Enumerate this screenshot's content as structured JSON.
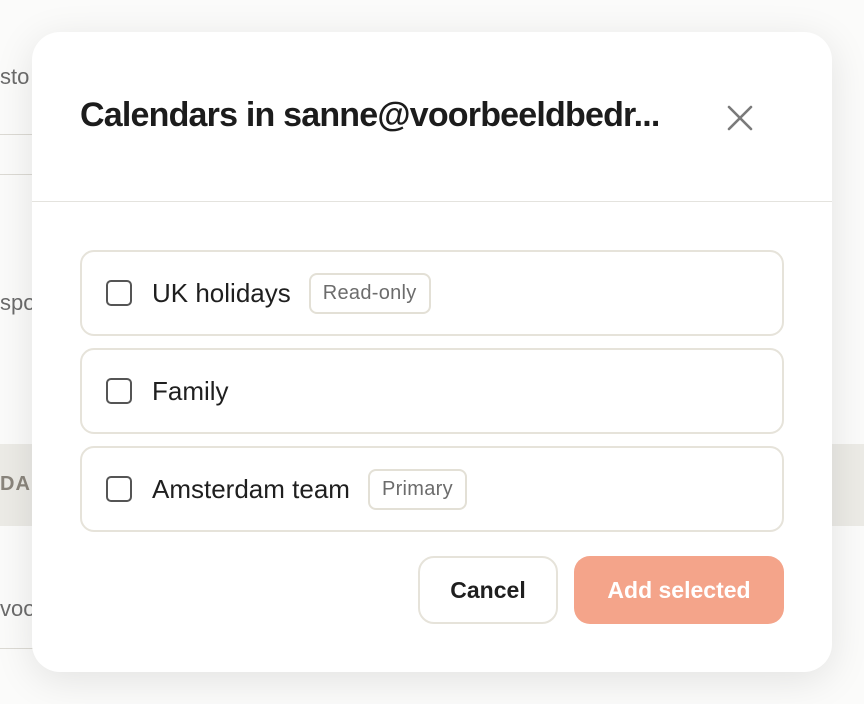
{
  "background": {
    "fragments": [
      "sto",
      "spo",
      "DA",
      "voo"
    ]
  },
  "modal": {
    "title": "Calendars in sanne@voorbeeldbedr...",
    "close_icon": "close-icon",
    "calendars": [
      {
        "label": "UK holidays",
        "badge": "Read-only",
        "checked": false
      },
      {
        "label": "Family",
        "checked": false
      },
      {
        "label": "Amsterdam team",
        "badge": "Primary",
        "checked": false
      }
    ],
    "cancel_label": "Cancel",
    "add_label": "Add selected"
  },
  "colors": {
    "accent": "#f4a48a",
    "border": "#e6e3da",
    "text": "#1c1c1c"
  }
}
